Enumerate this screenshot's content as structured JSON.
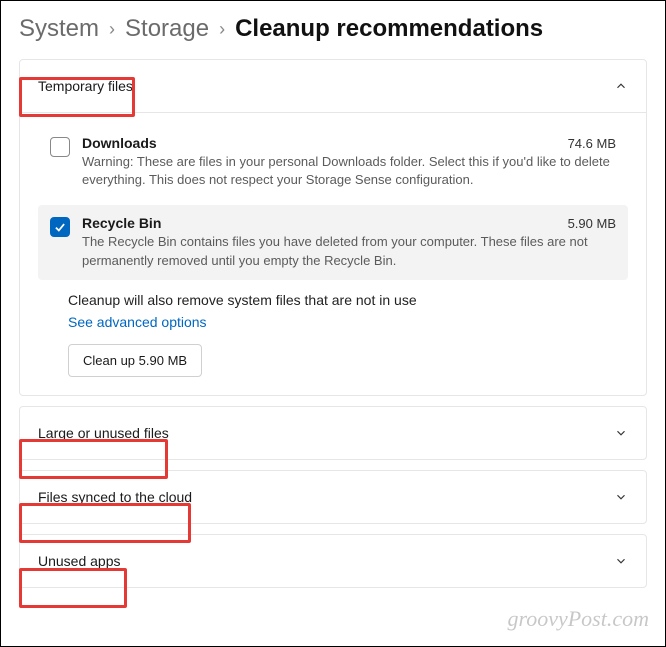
{
  "breadcrumbs": {
    "items": [
      "System",
      "Storage",
      "Cleanup recommendations"
    ]
  },
  "sections": {
    "temporary_files": {
      "title": "Temporary files",
      "expanded": true,
      "items": [
        {
          "title": "Downloads",
          "size": "74.6 MB",
          "desc": "Warning: These are files in your personal Downloads folder. Select this if you'd like to delete everything. This does not respect your Storage Sense configuration.",
          "checked": false
        },
        {
          "title": "Recycle Bin",
          "size": "5.90 MB",
          "desc": "The Recycle Bin contains files you have deleted from your computer. These files are not permanently removed until you empty the Recycle Bin.",
          "checked": true
        }
      ],
      "note": "Cleanup will also remove system files that are not in use",
      "advanced_link": "See advanced options",
      "button": "Clean up 5.90 MB"
    },
    "large_or_unused": {
      "title": "Large or unused files",
      "expanded": false
    },
    "synced_cloud": {
      "title": "Files synced to the cloud",
      "expanded": false
    },
    "unused_apps": {
      "title": "Unused apps",
      "expanded": false
    }
  },
  "watermark": "groovyPost.com"
}
